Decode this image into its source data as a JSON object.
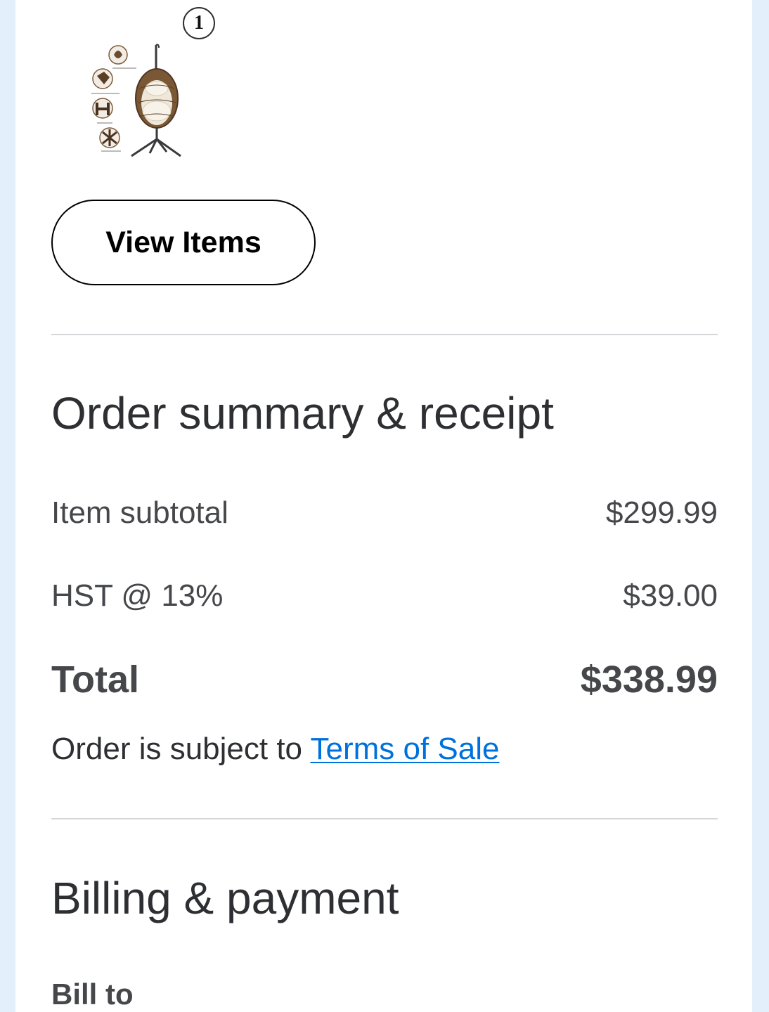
{
  "order_item": {
    "quantity_badge": "1",
    "image_alt": "Hanging egg chair with stand"
  },
  "actions": {
    "view_items_label": "View Items"
  },
  "order_summary": {
    "title": "Order summary & receipt",
    "rows": [
      {
        "label": "Item subtotal",
        "value": "$299.99"
      },
      {
        "label": "HST @ 13%",
        "value": "$39.00"
      }
    ],
    "total": {
      "label": "Total",
      "value": "$338.99"
    },
    "terms_prefix": "Order is subject to ",
    "terms_link": "Terms of Sale"
  },
  "billing": {
    "title": "Billing & payment",
    "bill_to_label": "Bill to"
  },
  "colors": {
    "page_background": "#e3f0fc",
    "link": "#0071dc",
    "text_primary": "#2e2f32",
    "text_secondary": "#46474a",
    "divider": "#d4d6d9"
  }
}
